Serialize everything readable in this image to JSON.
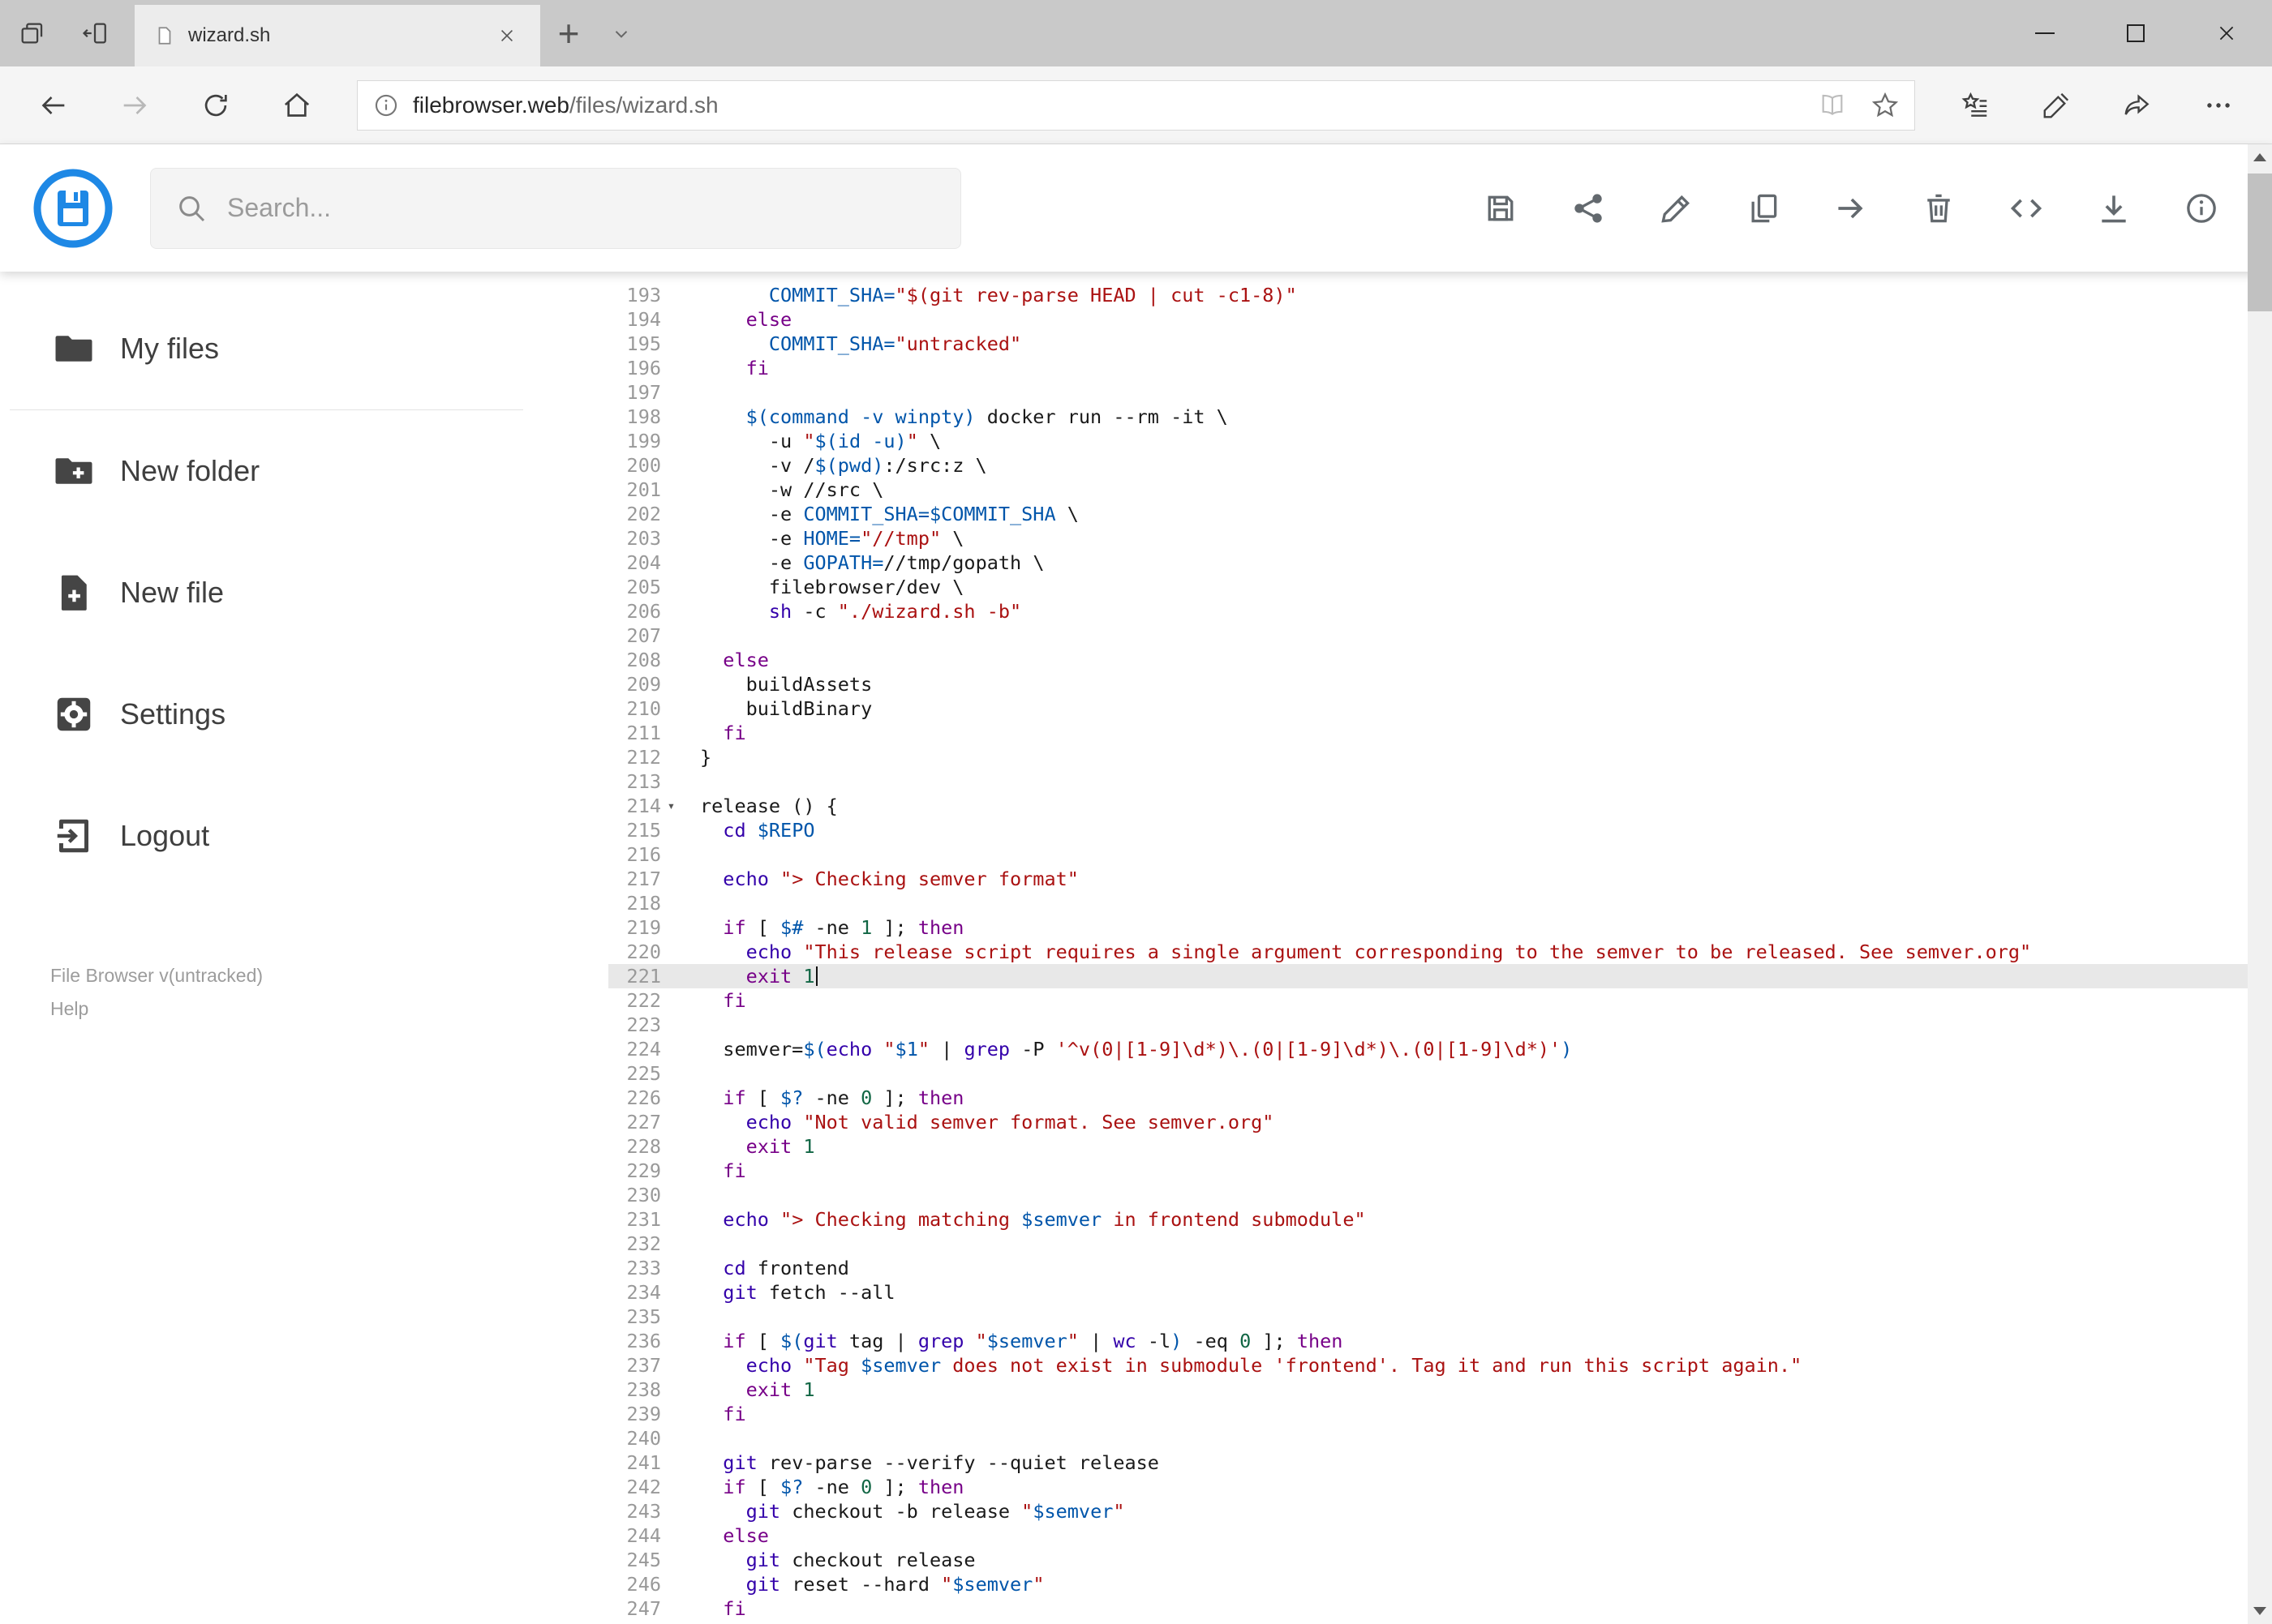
{
  "browser": {
    "tab_title": "wizard.sh",
    "url_domain": "filebrowser.web",
    "url_path": "/files/wizard.sh",
    "window_controls": [
      "minimize",
      "maximize",
      "close"
    ]
  },
  "header": {
    "search_placeholder": "Search...",
    "action_icons": [
      "save",
      "share",
      "edit",
      "copy",
      "move",
      "delete",
      "code",
      "download",
      "info"
    ],
    "logo_blue": "#1e88e5"
  },
  "sidebar": {
    "items": [
      {
        "label": "My files",
        "icon": "folder-icon"
      },
      {
        "label": "New folder",
        "icon": "new-folder-icon"
      },
      {
        "label": "New file",
        "icon": "new-file-icon"
      },
      {
        "label": "Settings",
        "icon": "settings-icon"
      },
      {
        "label": "Logout",
        "icon": "logout-icon"
      }
    ],
    "version": "File Browser v(untracked)",
    "help": "Help"
  },
  "editor": {
    "active_line": 221,
    "fold_line": 214,
    "colors": {
      "keyword": "#770088",
      "builtin": "#3300aa",
      "string": "#aa1111",
      "variable": "#0055aa",
      "number": "#116644",
      "plain": "#1a1a1a",
      "line_number": "#999999",
      "active_line_bg": "#e8e8e8"
    },
    "lines": [
      {
        "n": 193,
        "s": [
          [
            "pl",
            "      "
          ],
          [
            "va",
            "COMMIT_SHA="
          ],
          [
            "st",
            "\"$(git rev-parse HEAD | cut -c1-8)\""
          ]
        ]
      },
      {
        "n": 194,
        "s": [
          [
            "pl",
            "    "
          ],
          [
            "kw",
            "else"
          ]
        ]
      },
      {
        "n": 195,
        "s": [
          [
            "pl",
            "      "
          ],
          [
            "va",
            "COMMIT_SHA="
          ],
          [
            "st",
            "\"untracked\""
          ]
        ]
      },
      {
        "n": 196,
        "s": [
          [
            "pl",
            "    "
          ],
          [
            "kw",
            "fi"
          ]
        ]
      },
      {
        "n": 197,
        "s": []
      },
      {
        "n": 198,
        "s": [
          [
            "pl",
            "    "
          ],
          [
            "va",
            "$(command -v winpty)"
          ],
          [
            "pl",
            " docker run --rm -it \\"
          ]
        ]
      },
      {
        "n": 199,
        "s": [
          [
            "pl",
            "      -u "
          ],
          [
            "st",
            "\""
          ],
          [
            "va",
            "$(id -u)"
          ],
          [
            "st",
            "\""
          ],
          [
            "pl",
            " \\"
          ]
        ]
      },
      {
        "n": 200,
        "s": [
          [
            "pl",
            "      -v /"
          ],
          [
            "va",
            "$(pwd)"
          ],
          [
            "pl",
            ":/src:z \\"
          ]
        ]
      },
      {
        "n": 201,
        "s": [
          [
            "pl",
            "      -w //src \\"
          ]
        ]
      },
      {
        "n": 202,
        "s": [
          [
            "pl",
            "      -e "
          ],
          [
            "va",
            "COMMIT_SHA=$COMMIT_SHA"
          ],
          [
            "pl",
            " \\"
          ]
        ]
      },
      {
        "n": 203,
        "s": [
          [
            "pl",
            "      -e "
          ],
          [
            "va",
            "HOME="
          ],
          [
            "st",
            "\"//tmp\""
          ],
          [
            "pl",
            " \\"
          ]
        ]
      },
      {
        "n": 204,
        "s": [
          [
            "pl",
            "      -e "
          ],
          [
            "va",
            "GOPATH="
          ],
          [
            "pl",
            "//tmp/gopath \\"
          ]
        ]
      },
      {
        "n": 205,
        "s": [
          [
            "pl",
            "      filebrowser/dev \\"
          ]
        ]
      },
      {
        "n": 206,
        "s": [
          [
            "pl",
            "      "
          ],
          [
            "bi",
            "sh"
          ],
          [
            "pl",
            " -c "
          ],
          [
            "st",
            "\"./wizard.sh -b\""
          ]
        ]
      },
      {
        "n": 207,
        "s": []
      },
      {
        "n": 208,
        "s": [
          [
            "pl",
            "  "
          ],
          [
            "kw",
            "else"
          ]
        ]
      },
      {
        "n": 209,
        "s": [
          [
            "pl",
            "    buildAssets"
          ]
        ]
      },
      {
        "n": 210,
        "s": [
          [
            "pl",
            "    buildBinary"
          ]
        ]
      },
      {
        "n": 211,
        "s": [
          [
            "pl",
            "  "
          ],
          [
            "kw",
            "fi"
          ]
        ]
      },
      {
        "n": 212,
        "s": [
          [
            "pl",
            "}"
          ]
        ]
      },
      {
        "n": 213,
        "s": []
      },
      {
        "n": 214,
        "s": [
          [
            "pl",
            "release () {"
          ]
        ]
      },
      {
        "n": 215,
        "s": [
          [
            "pl",
            "  "
          ],
          [
            "bi",
            "cd"
          ],
          [
            "pl",
            " "
          ],
          [
            "va",
            "$REPO"
          ]
        ]
      },
      {
        "n": 216,
        "s": []
      },
      {
        "n": 217,
        "s": [
          [
            "pl",
            "  "
          ],
          [
            "bi",
            "echo"
          ],
          [
            "pl",
            " "
          ],
          [
            "st",
            "\"> Checking semver format\""
          ]
        ]
      },
      {
        "n": 218,
        "s": []
      },
      {
        "n": 219,
        "s": [
          [
            "pl",
            "  "
          ],
          [
            "kw",
            "if"
          ],
          [
            "pl",
            " [ "
          ],
          [
            "va",
            "$#"
          ],
          [
            "pl",
            " -ne "
          ],
          [
            "nu",
            "1"
          ],
          [
            "pl",
            " ]; "
          ],
          [
            "kw",
            "then"
          ]
        ]
      },
      {
        "n": 220,
        "s": [
          [
            "pl",
            "    "
          ],
          [
            "bi",
            "echo"
          ],
          [
            "pl",
            " "
          ],
          [
            "st",
            "\"This release script requires a single argument corresponding to the semver to be released. See semver.org\""
          ]
        ]
      },
      {
        "n": 221,
        "s": [
          [
            "pl",
            "    "
          ],
          [
            "kw",
            "exit"
          ],
          [
            "pl",
            " "
          ],
          [
            "nu",
            "1"
          ]
        ]
      },
      {
        "n": 222,
        "s": [
          [
            "pl",
            "  "
          ],
          [
            "kw",
            "fi"
          ]
        ]
      },
      {
        "n": 223,
        "s": []
      },
      {
        "n": 224,
        "s": [
          [
            "pl",
            "  semver="
          ],
          [
            "va",
            "$("
          ],
          [
            "bi",
            "echo"
          ],
          [
            "pl",
            " "
          ],
          [
            "st",
            "\""
          ],
          [
            "va",
            "$1"
          ],
          [
            "st",
            "\""
          ],
          [
            "pl",
            " | "
          ],
          [
            "bi",
            "grep"
          ],
          [
            "pl",
            " -P "
          ],
          [
            "st",
            "'^v(0|[1-9]\\d*)\\.(0|[1-9]\\d*)\\.(0|[1-9]\\d*)'"
          ],
          [
            "va",
            ")"
          ]
        ]
      },
      {
        "n": 225,
        "s": []
      },
      {
        "n": 226,
        "s": [
          [
            "pl",
            "  "
          ],
          [
            "kw",
            "if"
          ],
          [
            "pl",
            " [ "
          ],
          [
            "va",
            "$?"
          ],
          [
            "pl",
            " -ne "
          ],
          [
            "nu",
            "0"
          ],
          [
            "pl",
            " ]; "
          ],
          [
            "kw",
            "then"
          ]
        ]
      },
      {
        "n": 227,
        "s": [
          [
            "pl",
            "    "
          ],
          [
            "bi",
            "echo"
          ],
          [
            "pl",
            " "
          ],
          [
            "st",
            "\"Not valid semver format. See semver.org\""
          ]
        ]
      },
      {
        "n": 228,
        "s": [
          [
            "pl",
            "    "
          ],
          [
            "kw",
            "exit"
          ],
          [
            "pl",
            " "
          ],
          [
            "nu",
            "1"
          ]
        ]
      },
      {
        "n": 229,
        "s": [
          [
            "pl",
            "  "
          ],
          [
            "kw",
            "fi"
          ]
        ]
      },
      {
        "n": 230,
        "s": []
      },
      {
        "n": 231,
        "s": [
          [
            "pl",
            "  "
          ],
          [
            "bi",
            "echo"
          ],
          [
            "pl",
            " "
          ],
          [
            "st",
            "\"> Checking matching "
          ],
          [
            "va",
            "$semver"
          ],
          [
            "st",
            " in frontend submodule\""
          ]
        ]
      },
      {
        "n": 232,
        "s": []
      },
      {
        "n": 233,
        "s": [
          [
            "pl",
            "  "
          ],
          [
            "bi",
            "cd"
          ],
          [
            "pl",
            " frontend"
          ]
        ]
      },
      {
        "n": 234,
        "s": [
          [
            "pl",
            "  "
          ],
          [
            "bi",
            "git"
          ],
          [
            "pl",
            " fetch --all"
          ]
        ]
      },
      {
        "n": 235,
        "s": []
      },
      {
        "n": 236,
        "s": [
          [
            "pl",
            "  "
          ],
          [
            "kw",
            "if"
          ],
          [
            "pl",
            " [ "
          ],
          [
            "va",
            "$("
          ],
          [
            "bi",
            "git"
          ],
          [
            "pl",
            " tag | "
          ],
          [
            "bi",
            "grep"
          ],
          [
            "pl",
            " "
          ],
          [
            "st",
            "\""
          ],
          [
            "va",
            "$semver"
          ],
          [
            "st",
            "\""
          ],
          [
            "pl",
            " | "
          ],
          [
            "bi",
            "wc"
          ],
          [
            "pl",
            " -l"
          ],
          [
            "va",
            ")"
          ],
          [
            "pl",
            " -eq "
          ],
          [
            "nu",
            "0"
          ],
          [
            "pl",
            " ]; "
          ],
          [
            "kw",
            "then"
          ]
        ]
      },
      {
        "n": 237,
        "s": [
          [
            "pl",
            "    "
          ],
          [
            "bi",
            "echo"
          ],
          [
            "pl",
            " "
          ],
          [
            "st",
            "\"Tag "
          ],
          [
            "va",
            "$semver"
          ],
          [
            "st",
            " does not exist in submodule 'frontend'. Tag it and run this script again.\""
          ]
        ]
      },
      {
        "n": 238,
        "s": [
          [
            "pl",
            "    "
          ],
          [
            "kw",
            "exit"
          ],
          [
            "pl",
            " "
          ],
          [
            "nu",
            "1"
          ]
        ]
      },
      {
        "n": 239,
        "s": [
          [
            "pl",
            "  "
          ],
          [
            "kw",
            "fi"
          ]
        ]
      },
      {
        "n": 240,
        "s": []
      },
      {
        "n": 241,
        "s": [
          [
            "pl",
            "  "
          ],
          [
            "bi",
            "git"
          ],
          [
            "pl",
            " rev-parse --verify --quiet release"
          ]
        ]
      },
      {
        "n": 242,
        "s": [
          [
            "pl",
            "  "
          ],
          [
            "kw",
            "if"
          ],
          [
            "pl",
            " [ "
          ],
          [
            "va",
            "$?"
          ],
          [
            "pl",
            " -ne "
          ],
          [
            "nu",
            "0"
          ],
          [
            "pl",
            " ]; "
          ],
          [
            "kw",
            "then"
          ]
        ]
      },
      {
        "n": 243,
        "s": [
          [
            "pl",
            "    "
          ],
          [
            "bi",
            "git"
          ],
          [
            "pl",
            " checkout -b release "
          ],
          [
            "st",
            "\""
          ],
          [
            "va",
            "$semver"
          ],
          [
            "st",
            "\""
          ]
        ]
      },
      {
        "n": 244,
        "s": [
          [
            "pl",
            "  "
          ],
          [
            "kw",
            "else"
          ]
        ]
      },
      {
        "n": 245,
        "s": [
          [
            "pl",
            "    "
          ],
          [
            "bi",
            "git"
          ],
          [
            "pl",
            " checkout release"
          ]
        ]
      },
      {
        "n": 246,
        "s": [
          [
            "pl",
            "    "
          ],
          [
            "bi",
            "git"
          ],
          [
            "pl",
            " reset --hard "
          ],
          [
            "st",
            "\""
          ],
          [
            "va",
            "$semver"
          ],
          [
            "st",
            "\""
          ]
        ]
      },
      {
        "n": 247,
        "s": [
          [
            "pl",
            "  "
          ],
          [
            "kw",
            "fi"
          ]
        ]
      }
    ]
  }
}
